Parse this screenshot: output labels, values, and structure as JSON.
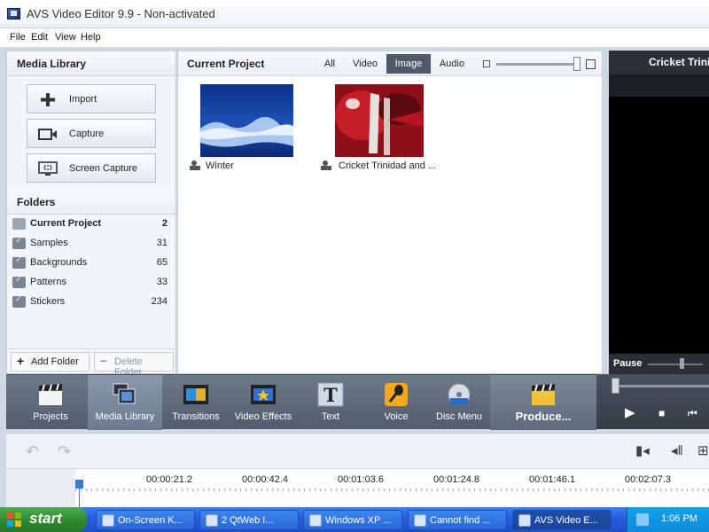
{
  "window": {
    "title": "AVS Video Editor 9.9 - Non-activated"
  },
  "menu": [
    "File",
    "Edit",
    "View",
    "Help"
  ],
  "media_library": {
    "title": "Media Library",
    "buttons": [
      {
        "label": "Import",
        "icon": "plus-icon"
      },
      {
        "label": "Capture",
        "icon": "camera-icon"
      },
      {
        "label": "Screen Capture",
        "icon": "screen-capture-icon"
      }
    ],
    "folders_title": "Folders",
    "folders": [
      {
        "name": "Current Project",
        "count": "2",
        "selected": true
      },
      {
        "name": "Samples",
        "count": "31"
      },
      {
        "name": "Backgrounds",
        "count": "65"
      },
      {
        "name": "Patterns",
        "count": "33"
      },
      {
        "name": "Stickers",
        "count": "234"
      }
    ],
    "add_folder": "Add Folder",
    "delete_folder": "Delete Folder"
  },
  "current_project": {
    "title": "Current Project",
    "filters": [
      "All",
      "Video",
      "Image",
      "Audio"
    ],
    "active_filter": "Image",
    "items": [
      {
        "caption": "Winter"
      },
      {
        "caption": "Cricket Trinidad and ..."
      }
    ]
  },
  "preview": {
    "title": "Cricket Trini",
    "status": "Pause"
  },
  "toolbar": {
    "tools": [
      {
        "label": "Projects",
        "icon": "clapperboard-icon"
      },
      {
        "label": "Media Library",
        "icon": "media-library-icon",
        "active": true
      },
      {
        "label": "Transitions",
        "icon": "transitions-icon"
      },
      {
        "label": "Video Effects",
        "icon": "video-effects-icon"
      },
      {
        "label": "Text",
        "icon": "text-icon"
      },
      {
        "label": "Voice",
        "icon": "microphone-icon"
      },
      {
        "label": "Disc Menu",
        "icon": "disc-icon"
      }
    ],
    "produce_label": "Produce..."
  },
  "timeline": {
    "ticks": [
      "00:00:21.2",
      "00:00:42.4",
      "00:01:03.6",
      "00:01:24.8",
      "00:01:46.1",
      "00:02:07.3"
    ]
  },
  "taskbar": {
    "start": "start",
    "tasks": [
      {
        "label": "On-Screen K..."
      },
      {
        "label": "2 QtWeb I..."
      },
      {
        "label": "Windows XP ..."
      },
      {
        "label": "Cannot find ..."
      },
      {
        "label": "AVS Video E...",
        "active": true
      }
    ],
    "clock": "1:06 PM"
  }
}
